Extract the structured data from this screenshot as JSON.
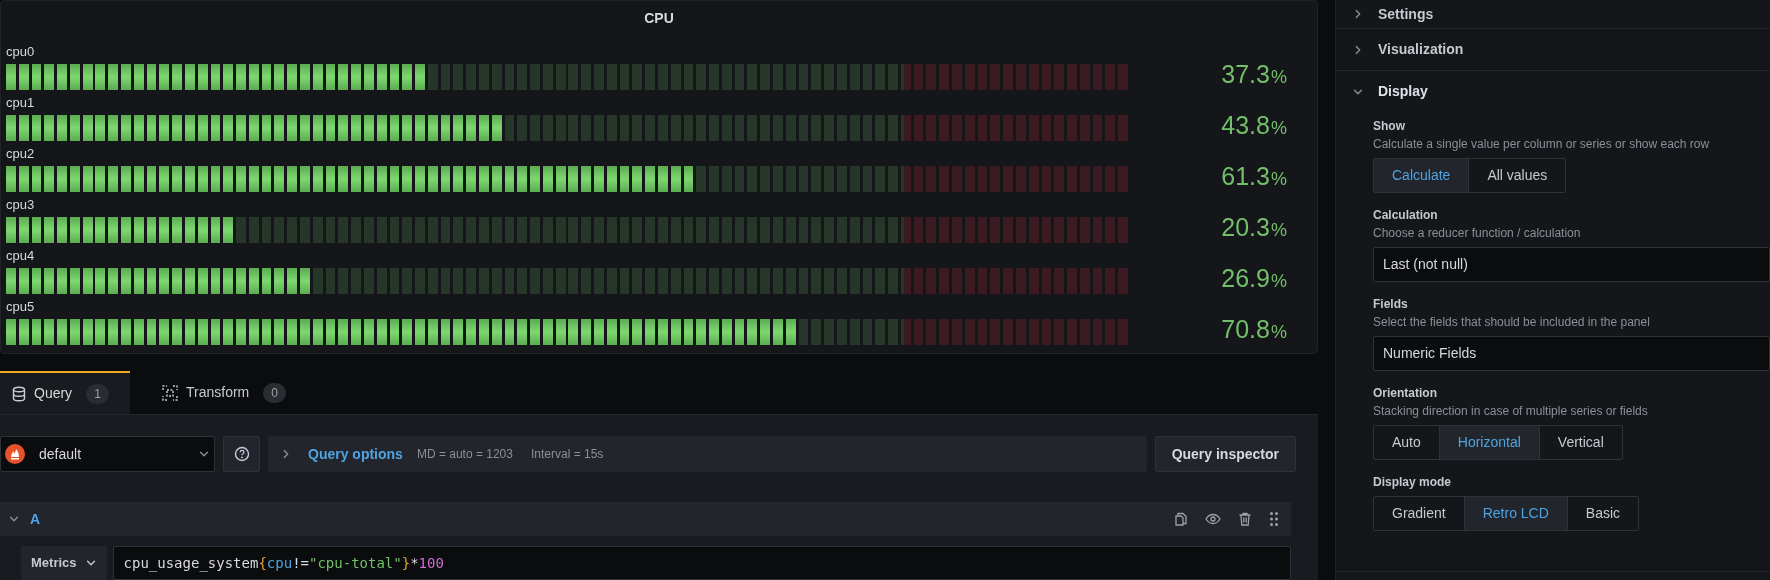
{
  "panel": {
    "title": "CPU",
    "gauges": [
      {
        "name": "cpu0",
        "level": 0.373,
        "value": "37.3",
        "unit": "%"
      },
      {
        "name": "cpu1",
        "level": 0.438,
        "value": "43.8",
        "unit": "%"
      },
      {
        "name": "cpu2",
        "level": 0.613,
        "value": "61.3",
        "unit": "%"
      },
      {
        "name": "cpu3",
        "level": 0.203,
        "value": "20.3",
        "unit": "%"
      },
      {
        "name": "cpu4",
        "level": 0.269,
        "value": "26.9",
        "unit": "%"
      },
      {
        "name": "cpu5",
        "level": 0.708,
        "value": "70.8",
        "unit": "%"
      }
    ]
  },
  "query_tabs": [
    {
      "label": "Query",
      "count": "1",
      "selected": true,
      "kind": "database"
    },
    {
      "label": "Transform",
      "count": "0",
      "selected": false,
      "kind": "transform"
    }
  ],
  "datasource": {
    "value": "default"
  },
  "query_options": {
    "label": "Query options",
    "expanded": false,
    "max_data_points": "MD = auto = 1203",
    "interval": "Interval = 15s"
  },
  "inspector_button": "Query inspector",
  "query": {
    "ref": "A",
    "expanded": true,
    "editor_mode": "Metrics",
    "expression": [
      {
        "text": "cpu_usage_system",
        "kind": "ident"
      },
      {
        "text": "{",
        "kind": "brace"
      },
      {
        "text": "cpu",
        "kind": "label"
      },
      {
        "text": "!=",
        "kind": "ident"
      },
      {
        "text": "\"cpu-total\"",
        "kind": "string"
      },
      {
        "text": "}",
        "kind": "brace"
      },
      {
        "text": "*",
        "kind": "ident"
      },
      {
        "text": "100",
        "kind": "number"
      }
    ]
  },
  "options": {
    "sections": [
      {
        "title": "Settings",
        "expanded": false
      },
      {
        "title": "Visualization",
        "expanded": false
      },
      {
        "title": "Display",
        "expanded": true
      }
    ],
    "fields": [
      {
        "kind": "radio",
        "label": "Show",
        "description": "Calculate a single value per column or series or show each row",
        "options": [
          {
            "label": "Calculate",
            "selected": true
          },
          {
            "label": "All values",
            "selected": false
          }
        ]
      },
      {
        "kind": "select",
        "label": "Calculation",
        "description": "Choose a reducer function / calculation",
        "value": "Last (not null)"
      },
      {
        "kind": "select",
        "label": "Fields",
        "description": "Select the fields that should be included in the panel",
        "value": "Numeric Fields"
      },
      {
        "kind": "radio",
        "label": "Orientation",
        "description": "Stacking direction in case of multiple series or fields",
        "options": [
          {
            "label": "Auto",
            "selected": false
          },
          {
            "label": "Horizontal",
            "selected": true
          },
          {
            "label": "Vertical",
            "selected": false
          }
        ]
      },
      {
        "kind": "radio",
        "label": "Display mode",
        "options": [
          {
            "label": "Gradient",
            "selected": false
          },
          {
            "label": "Retro LCD",
            "selected": true
          },
          {
            "label": "Basic",
            "selected": false
          }
        ]
      }
    ]
  }
}
